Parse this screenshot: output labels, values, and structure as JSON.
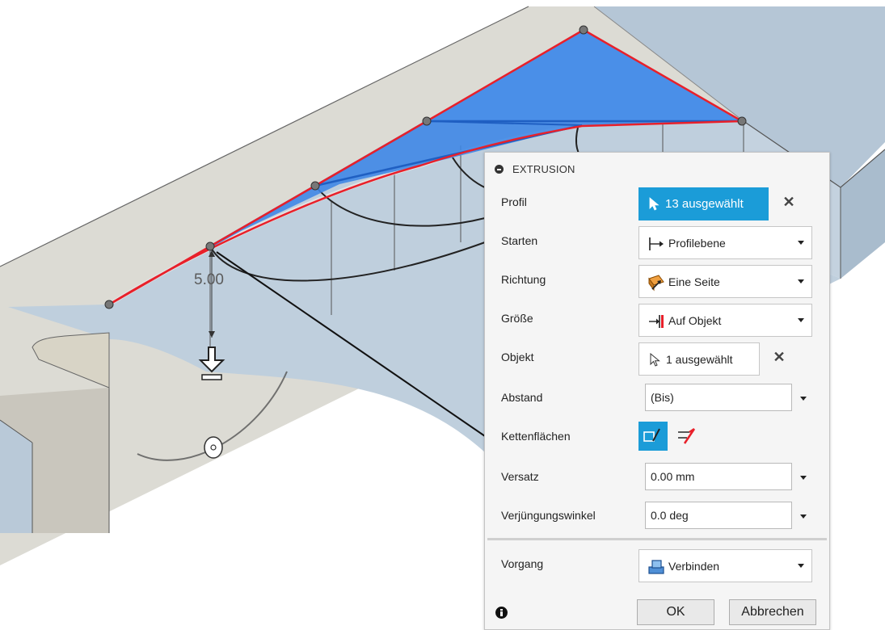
{
  "viewport": {
    "dimension_label": "5.00"
  },
  "panel": {
    "title": "EXTRUSION",
    "rows": {
      "profil": {
        "label": "Profil",
        "value": "13 ausgewählt"
      },
      "starten": {
        "label": "Starten",
        "value": "Profilebene"
      },
      "richtung": {
        "label": "Richtung",
        "value": "Eine Seite"
      },
      "groesse": {
        "label": "Größe",
        "value": "Auf Objekt"
      },
      "objekt": {
        "label": "Objekt",
        "value": "1 ausgewählt"
      },
      "abstand": {
        "label": "Abstand",
        "value": "(Bis)"
      },
      "kettenflaechen": {
        "label": "Kettenflächen"
      },
      "versatz": {
        "label": "Versatz",
        "value": "0.00 mm"
      },
      "verjuengungswinkel": {
        "label": "Verjüngungswinkel",
        "value": "0.0 deg"
      },
      "vorgang": {
        "label": "Vorgang",
        "value": "Verbinden"
      }
    },
    "ok_label": "OK",
    "cancel_label": "Abbrechen",
    "close_symbol": "✕"
  },
  "colors": {
    "accent": "#1b9cd8",
    "profile_fill": "#3d86e6",
    "edge_highlight": "#e8202a",
    "body_top": "#dcdbd4",
    "body_side": "#b7c8d9"
  },
  "icons": [
    "collapse-icon",
    "select-arrow-icon",
    "start-plane-icon",
    "direction-icon",
    "extent-icon",
    "chain-faces-icon",
    "join-icon",
    "info-icon",
    "extrude-arrow-icon",
    "rotate-handle-icon"
  ]
}
